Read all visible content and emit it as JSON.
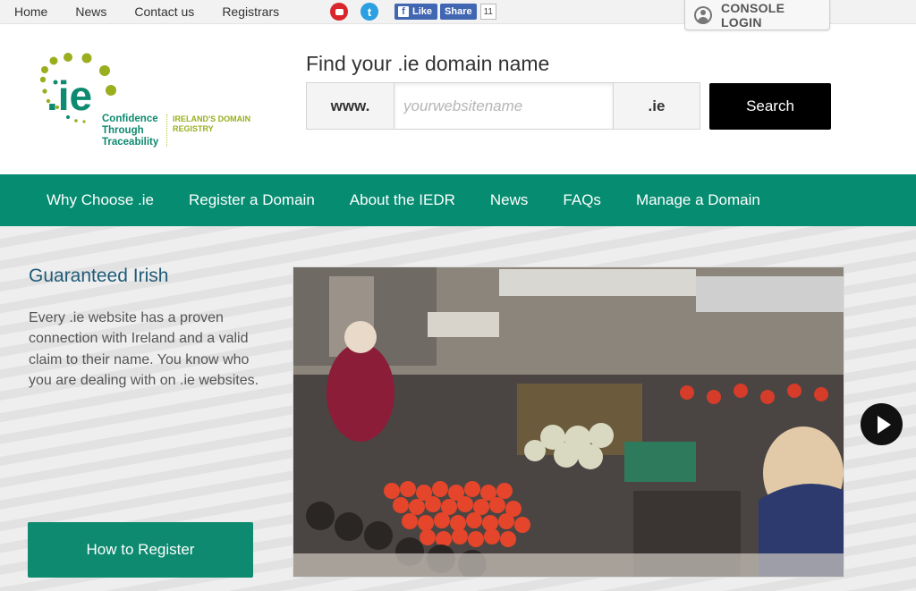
{
  "topnav": {
    "items": [
      "Home",
      "News",
      "Contact us",
      "Registrars"
    ]
  },
  "social": {
    "youtube_icon": "youtube-icon",
    "twitter_icon": "twitter-icon",
    "fb_like_label": "Like",
    "fb_share_label": "Share",
    "fb_count": "11"
  },
  "console": {
    "label": "CONSOLE LOGIN",
    "icon": "user-icon"
  },
  "logo": {
    "mark_text": ".ie",
    "tagline": [
      "Confidence",
      "Through",
      "Traceability"
    ],
    "registry": [
      "IRELAND'S DOMAIN",
      "REGISTRY"
    ]
  },
  "search": {
    "title": "Find your .ie domain name",
    "prefix": "www.",
    "placeholder": "yourwebsitename",
    "value": "",
    "suffix": ".ie",
    "button_label": "Search"
  },
  "mainnav": {
    "items": [
      "Why Choose .ie",
      "Register a Domain",
      "About the IEDR",
      "News",
      "FAQs",
      "Manage a Domain"
    ]
  },
  "hero": {
    "title": "Guaranteed Irish",
    "text": "Every .ie website has a proven connection with Ireland and a valid claim to their name. You know who you are dealing with on .ie websites.",
    "button_label": "How to Register",
    "next_icon": "play-next-icon"
  },
  "colors": {
    "brand_green": "#058c71",
    "logo_lime": "#9aae1e",
    "heading_blue": "#1f5b77"
  }
}
